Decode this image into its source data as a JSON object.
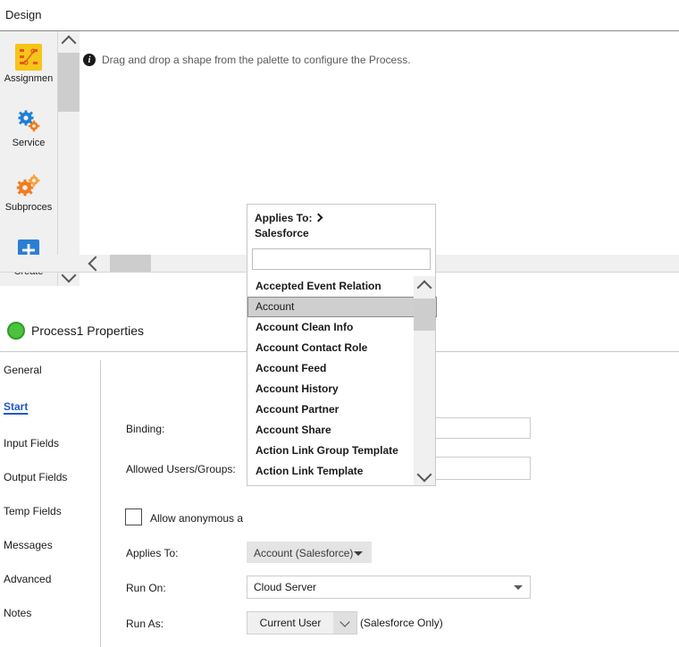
{
  "design": {
    "title": "Design",
    "hint": "Drag and drop a shape from the palette to configure the Process.",
    "info_icon": "info-icon"
  },
  "palette": {
    "items": [
      {
        "label": "Assignmen",
        "icon": "assignment-icon"
      },
      {
        "label": "Service",
        "icon": "service-gears-icon"
      },
      {
        "label": "Subproces",
        "icon": "subprocess-gears-icon"
      },
      {
        "label": "Create",
        "icon": "create-plus-icon"
      }
    ],
    "scroll_up_icon": "chevron-up-icon",
    "scroll_down_icon": "chevron-down-icon"
  },
  "hscroll": {
    "left_icon": "chevron-left-icon"
  },
  "properties": {
    "title": "Process1 Properties",
    "status_icon": "green-circle-icon",
    "tabs": [
      {
        "label": "General",
        "active": false
      },
      {
        "label": "Start",
        "active": true
      },
      {
        "label": "Input Fields",
        "active": false
      },
      {
        "label": "Output Fields",
        "active": false
      },
      {
        "label": "Temp Fields",
        "active": false
      },
      {
        "label": "Messages",
        "active": false
      },
      {
        "label": "Advanced",
        "active": false
      },
      {
        "label": "Notes",
        "active": false
      }
    ],
    "fields": {
      "binding_label": "Binding:",
      "binding_value": "",
      "allowed_users_label": "Allowed Users/Groups:",
      "allowed_users_value": "",
      "allow_anonymous_label": "Allow anonymous a",
      "allow_anonymous_checked": false,
      "applies_to_label": "Applies To:",
      "applies_to_value": "Account (Salesforce)",
      "run_on_label": "Run On:",
      "run_on_value": "Cloud Server",
      "run_as_label": "Run As:",
      "run_as_value": "Current User",
      "run_as_note": "(Salesforce Only)"
    }
  },
  "popup": {
    "heading_prefix": "Applies To:",
    "heading_arrow_icon": "chevron-right-icon",
    "heading_source": "Salesforce",
    "search_value": "",
    "search_placeholder": "",
    "scroll_up_icon": "chevron-up-icon",
    "scroll_down_icon": "chevron-down-icon",
    "items": [
      {
        "label": "Accepted Event Relation",
        "selected": false
      },
      {
        "label": "Account",
        "selected": true
      },
      {
        "label": "Account Clean Info",
        "selected": false
      },
      {
        "label": "Account Contact Role",
        "selected": false
      },
      {
        "label": "Account Feed",
        "selected": false
      },
      {
        "label": "Account History",
        "selected": false
      },
      {
        "label": "Account Partner",
        "selected": false
      },
      {
        "label": "Account Share",
        "selected": false
      },
      {
        "label": "Action Link Group Template",
        "selected": false
      },
      {
        "label": "Action Link Template",
        "selected": false
      }
    ]
  },
  "colors": {
    "accent": "#2159c9",
    "status_green": "#4cc23f",
    "assignment_yellow": "#f5c518",
    "gear_blue": "#1e7fd4",
    "gear_orange": "#f07c1e",
    "create_blue": "#2a7fd4",
    "scroll_thumb": "#cdcdcd"
  }
}
